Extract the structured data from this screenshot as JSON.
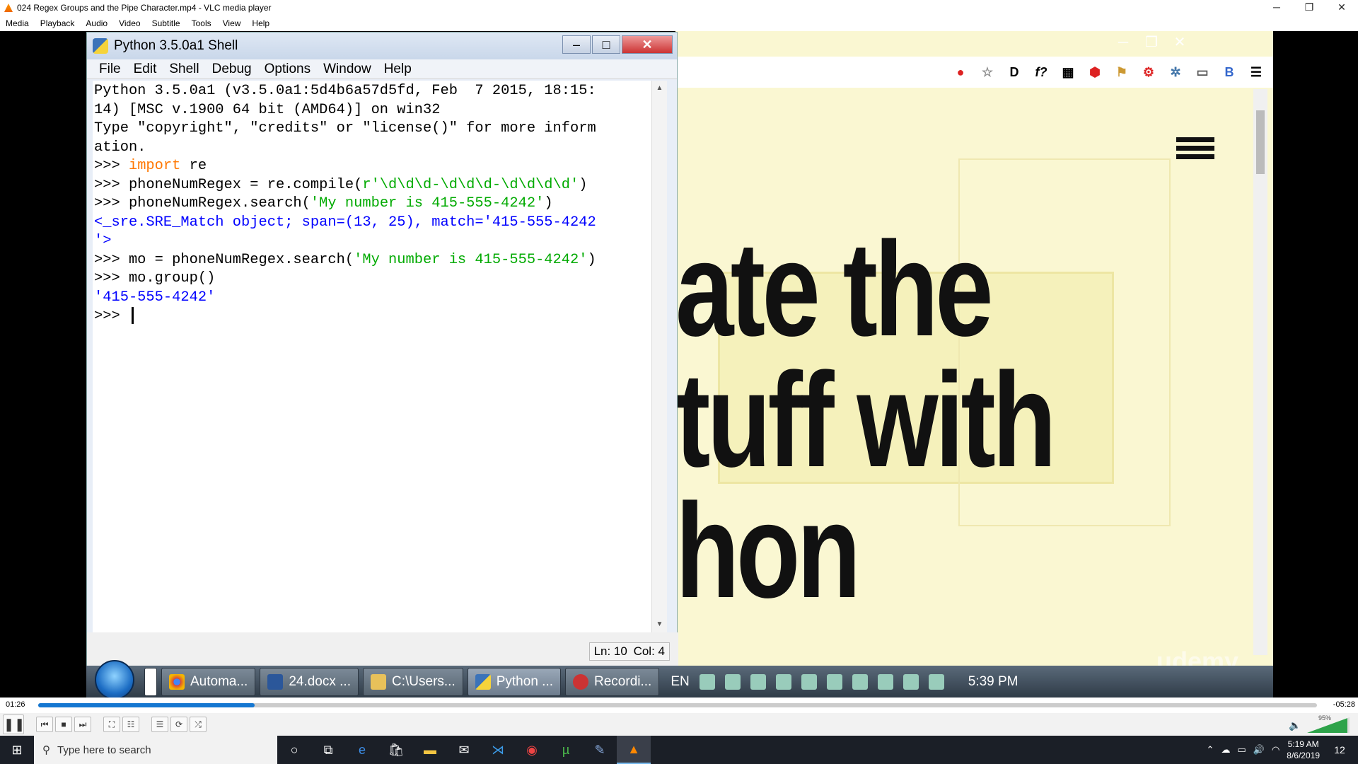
{
  "window": {
    "title": "024 Regex Groups and the Pipe Character.mp4 - VLC media player",
    "buttons": [
      "─",
      "❐",
      "✕"
    ]
  },
  "vlc_menu": [
    "Media",
    "Playback",
    "Audio",
    "Video",
    "Subtitle",
    "Tools",
    "View",
    "Help"
  ],
  "idle": {
    "title": "Python 3.5.0a1 Shell",
    "menu": [
      "File",
      "Edit",
      "Shell",
      "Debug",
      "Options",
      "Window",
      "Help"
    ],
    "lines": [
      "Python 3.5.0a1 (v3.5.0a1:5d4b6a57d5fd, Feb  7 2015, 18:15:",
      "14) [MSC v.1900 64 bit (AMD64)] on win32",
      "Type \"copyright\", \"credits\" or \"license()\" for more inform",
      "ation.",
      ">>> import re",
      ">>> phoneNumRegex = re.compile(r'\\d\\d\\d-\\d\\d\\d-\\d\\d\\d\\d')",
      ">>> phoneNumRegex.search('My number is 415-555-4242')",
      "<_sre.SRE_Match object; span=(13, 25), match='415-555-4242",
      "'>",
      ">>> mo = phoneNumRegex.search('My number is 415-555-4242')",
      ">>> mo.group()",
      "'415-555-4242'",
      ">>> "
    ],
    "status": {
      "ln": "Ln: 10",
      "col": "Col: 4"
    },
    "colors": {
      "keyword": "#ff7700",
      "string": "#00aa00",
      "output": "#0000ff"
    }
  },
  "slide": {
    "lines": [
      "ate the",
      "tuff with",
      "hon"
    ],
    "watermark": "udemy"
  },
  "win7_taskbar": {
    "tasks": [
      "Automa...",
      "24.docx ...",
      "C:\\Users...",
      "Python ...",
      "Recordi..."
    ],
    "lang": "EN",
    "time": "5:39 PM"
  },
  "vlc_player": {
    "elapsed": "01:26",
    "remaining": "-05:28",
    "progress_fraction": 0.169,
    "volume": "95%",
    "accent": "#1577d1"
  },
  "win10_taskbar": {
    "search_placeholder": "Type here to search",
    "time": "5:19 AM",
    "date": "8/6/2019",
    "notifications": "12"
  }
}
